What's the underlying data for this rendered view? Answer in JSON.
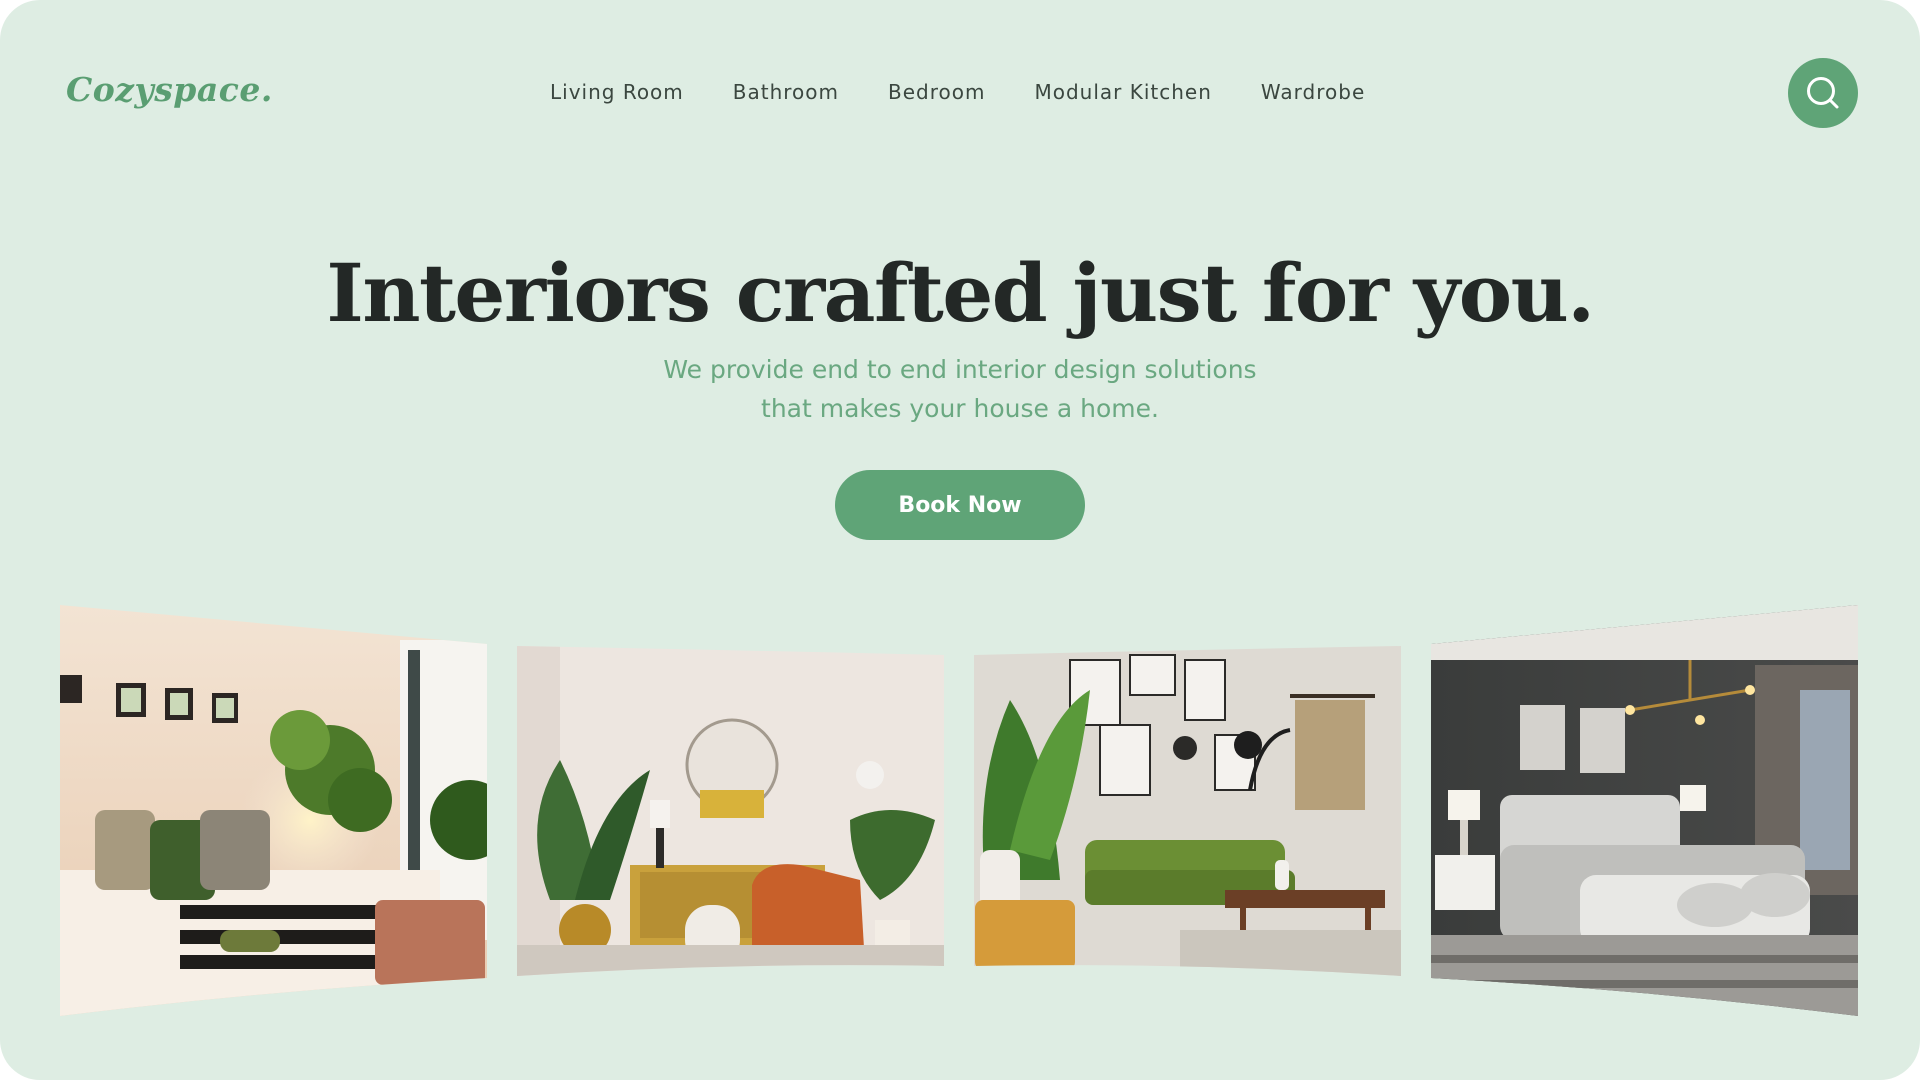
{
  "brand": {
    "name": "Cozyspace."
  },
  "nav": {
    "items": [
      "Living Room",
      "Bathroom",
      "Bedroom",
      "Modular Kitchen",
      "Wardrobe"
    ]
  },
  "search": {
    "icon": "search-icon"
  },
  "hero": {
    "title": "Interiors crafted just for you.",
    "subtitle_line1": "We provide end to end interior design solutions",
    "subtitle_line2": "that makes your house a home.",
    "cta_label": "Book Now"
  },
  "gallery": {
    "photos": [
      "bedroom-photo",
      "living-room-photo",
      "green-sofa-living-room-photo",
      "grey-bedroom-photo"
    ]
  },
  "colors": {
    "background": "#deede3",
    "accent": "#5fa477",
    "heading": "#232826",
    "subtitle": "#6aa881"
  }
}
